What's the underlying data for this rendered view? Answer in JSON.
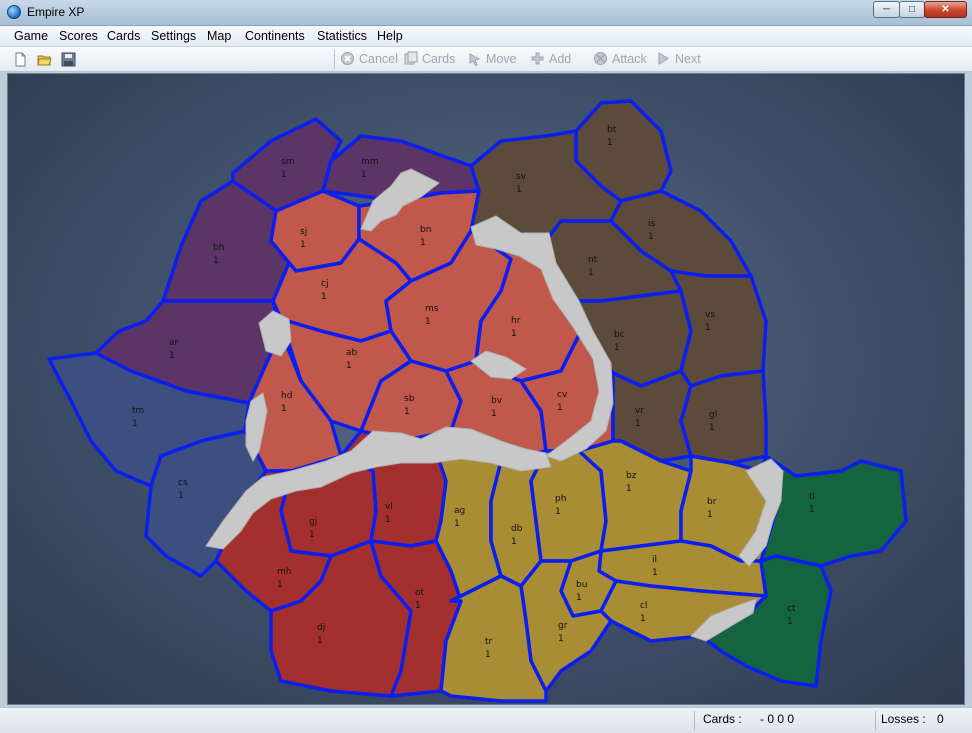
{
  "window": {
    "title": "Empire XP"
  },
  "menu": [
    "Game",
    "Scores",
    "Cards",
    "Settings",
    "Map",
    "Continents",
    "Statistics",
    "Help"
  ],
  "toolbar": {
    "file_icons": [
      "new-file-icon",
      "open-folder-icon",
      "save-disk-icon"
    ],
    "buttons": [
      {
        "label": "Cancel",
        "icon": "cancel-icon"
      },
      {
        "label": "Cards",
        "icon": "cards-icon"
      },
      {
        "label": "Move",
        "icon": "move-icon"
      },
      {
        "label": "Add",
        "icon": "add-icon"
      },
      {
        "label": "Attack",
        "icon": "attack-icon"
      },
      {
        "label": "Next",
        "icon": "next-icon"
      }
    ]
  },
  "colors": {
    "purple": "#5b3566",
    "brown": "#5c4b3a",
    "salmon": "#c0584c",
    "red": "#a3302f",
    "gold": "#a88d35",
    "green": "#13643f",
    "slate": "#3d4f81",
    "border": "#0a1ef0"
  },
  "regions": [
    {
      "code": "sm",
      "armies": "1",
      "color": "purple"
    },
    {
      "code": "mm",
      "armies": "1",
      "color": "purple"
    },
    {
      "code": "bh",
      "armies": "1",
      "color": "purple"
    },
    {
      "code": "ar",
      "armies": "1",
      "color": "purple"
    },
    {
      "code": "tm",
      "armies": "1",
      "color": "slate"
    },
    {
      "code": "cs",
      "armies": "1",
      "color": "slate"
    },
    {
      "code": "sj",
      "armies": "1",
      "color": "salmon"
    },
    {
      "code": "bn",
      "armies": "1",
      "color": "salmon"
    },
    {
      "code": "cj",
      "armies": "1",
      "color": "salmon"
    },
    {
      "code": "ms",
      "armies": "1",
      "color": "salmon"
    },
    {
      "code": "hr",
      "armies": "1",
      "color": "salmon"
    },
    {
      "code": "ab",
      "armies": "1",
      "color": "salmon"
    },
    {
      "code": "hd",
      "armies": "1",
      "color": "salmon"
    },
    {
      "code": "sb",
      "armies": "1",
      "color": "salmon"
    },
    {
      "code": "bv",
      "armies": "1",
      "color": "salmon"
    },
    {
      "code": "cv",
      "armies": "1",
      "color": "salmon"
    },
    {
      "code": "bt",
      "armies": "1",
      "color": "brown"
    },
    {
      "code": "sv",
      "armies": "1",
      "color": "brown"
    },
    {
      "code": "is",
      "armies": "1",
      "color": "brown"
    },
    {
      "code": "nt",
      "armies": "1",
      "color": "brown"
    },
    {
      "code": "bc",
      "armies": "1",
      "color": "brown"
    },
    {
      "code": "vs",
      "armies": "1",
      "color": "brown"
    },
    {
      "code": "vr",
      "armies": "1",
      "color": "brown"
    },
    {
      "code": "gl",
      "armies": "1",
      "color": "brown"
    },
    {
      "code": "gj",
      "armies": "1",
      "color": "red"
    },
    {
      "code": "vl",
      "armies": "1",
      "color": "red"
    },
    {
      "code": "mh",
      "armies": "1",
      "color": "red"
    },
    {
      "code": "dj",
      "armies": "1",
      "color": "red"
    },
    {
      "code": "ot",
      "armies": "1",
      "color": "red"
    },
    {
      "code": "ag",
      "armies": "1",
      "color": "gold"
    },
    {
      "code": "db",
      "armies": "1",
      "color": "gold"
    },
    {
      "code": "ph",
      "armies": "1",
      "color": "gold"
    },
    {
      "code": "bz",
      "armies": "1",
      "color": "gold"
    },
    {
      "code": "br",
      "armies": "1",
      "color": "gold"
    },
    {
      "code": "il",
      "armies": "1",
      "color": "gold"
    },
    {
      "code": "bu",
      "armies": "1",
      "color": "gold"
    },
    {
      "code": "cl",
      "armies": "1",
      "color": "gold"
    },
    {
      "code": "gr",
      "armies": "1",
      "color": "gold"
    },
    {
      "code": "tr",
      "armies": "1",
      "color": "gold"
    },
    {
      "code": "tl",
      "armies": "1",
      "color": "green"
    },
    {
      "code": "ct",
      "armies": "1",
      "color": "green"
    }
  ],
  "status": {
    "cards_label": "Cards :",
    "cards_value": "- 0 0 0",
    "losses_label": "Losses :",
    "losses_value": "0"
  }
}
